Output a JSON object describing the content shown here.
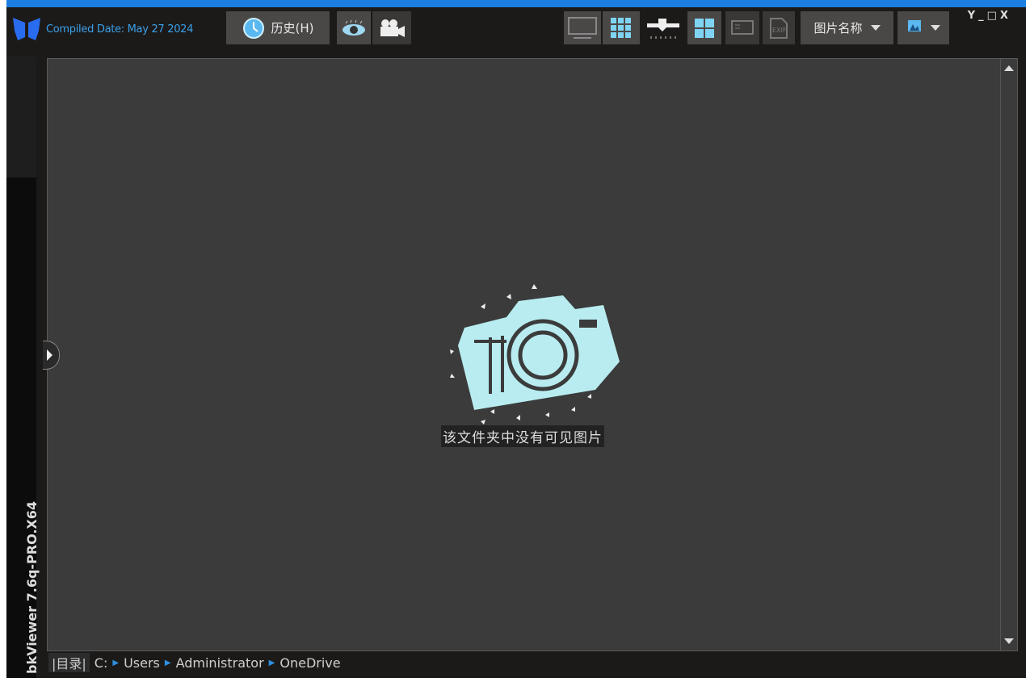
{
  "app": {
    "compiled_date": "Compiled Date: May 27 2024",
    "version_label": "bkViewer 7.6q-PRO.X64"
  },
  "toolbar": {
    "history_label": "历史(H)",
    "sort_label": "图片名称",
    "window_controls": "Y_□X"
  },
  "icons": [
    "butterfly-logo-icon",
    "clock-icon",
    "eye-icon",
    "video-camera-icon",
    "monitor-thumbnails-icon",
    "grid-icon",
    "slider-icon",
    "four-grid-icon",
    "info-panel-icon",
    "exif-icon",
    "image-icon"
  ],
  "main": {
    "empty_message": "该文件夹中没有可见图片"
  },
  "path": {
    "dir_label": "|目录|",
    "segments": [
      "C:",
      "Users",
      "Administrator",
      "OneDrive"
    ]
  },
  "colors": {
    "accent": "#1a7fe0",
    "camera": "#b8ecf0"
  }
}
